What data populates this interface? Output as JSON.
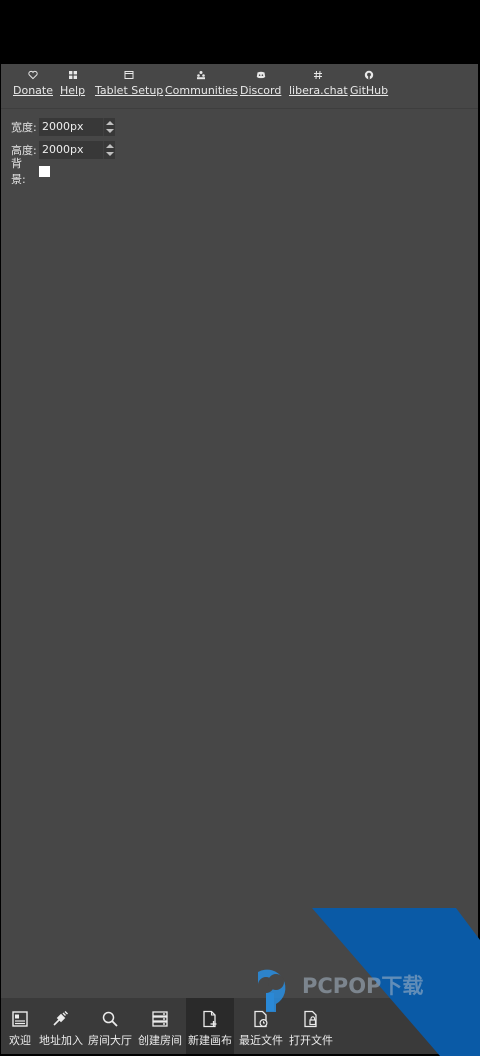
{
  "links": [
    {
      "label": "Donate",
      "icon": "heart-icon"
    },
    {
      "label": "Help",
      "icon": "grid-icon"
    },
    {
      "label": "Tablet Setup",
      "icon": "tablet-icon"
    },
    {
      "label": "Communities",
      "icon": "people-icon"
    },
    {
      "label": "Discord",
      "icon": "discord-icon"
    },
    {
      "label": "libera.chat",
      "icon": "hash-icon"
    },
    {
      "label": "GitHub",
      "icon": "github-icon"
    }
  ],
  "form": {
    "width_label": "宽度:",
    "width_value": "2000px",
    "height_label": "高度:",
    "height_value": "2000px",
    "background_label": "背景:",
    "background_color": "#ffffff"
  },
  "toolbar": [
    {
      "label": "欢迎",
      "icon": "welcome-icon"
    },
    {
      "label": "地址加入",
      "icon": "plug-icon"
    },
    {
      "label": "房间大厅",
      "icon": "search-icon"
    },
    {
      "label": "创建房间",
      "icon": "server-icon"
    },
    {
      "label": "新建画布",
      "icon": "new-document-icon",
      "active": true
    },
    {
      "label": "最近文件",
      "icon": "recent-file-icon"
    },
    {
      "label": "打开文件",
      "icon": "open-file-icon"
    }
  ],
  "watermark": {
    "text": "PCPOP下载"
  },
  "colors": {
    "background": "#474747",
    "toolbar": "#3a3a3a",
    "watermark_blue": "#0a5aa6"
  }
}
